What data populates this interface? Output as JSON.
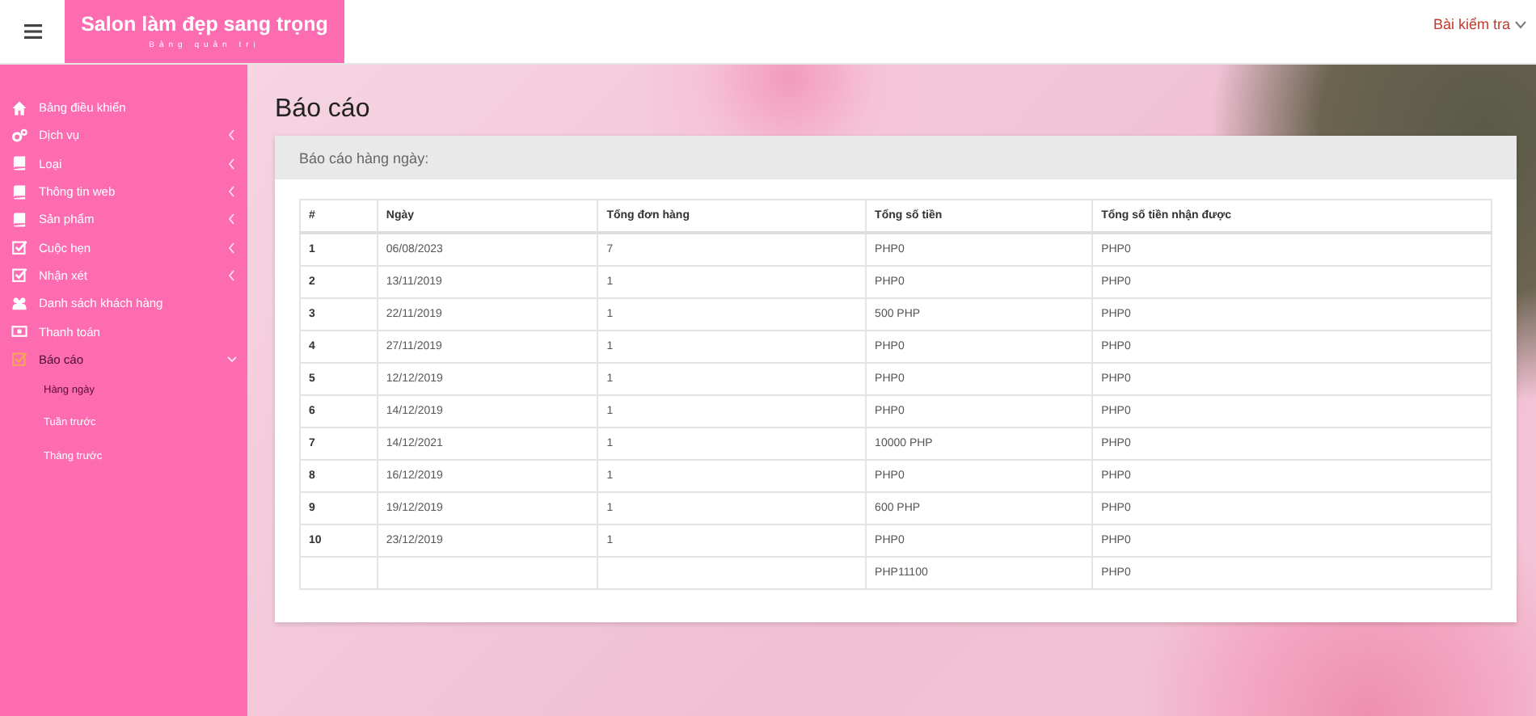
{
  "header": {
    "brand_title": "Salon làm đẹp sang trọng",
    "brand_subtitle": "Bảng quản trị",
    "user_menu": "Bài kiểm tra"
  },
  "sidebar": {
    "items": [
      {
        "kind": "home",
        "label": "Bảng điều khiển",
        "selected": false
      },
      {
        "kind": "gears",
        "label": "Dịch vụ",
        "selected": false,
        "expanded": false
      },
      {
        "kind": "book",
        "label": "Loại",
        "selected": false,
        "expanded": false
      },
      {
        "kind": "book",
        "label": "Thông tin web",
        "selected": false,
        "expanded": false
      },
      {
        "kind": "book",
        "label": "Sản phẩm",
        "selected": false,
        "expanded": false
      },
      {
        "kind": "check",
        "label": "Cuộc hẹn",
        "selected": false,
        "expanded": false
      },
      {
        "kind": "check",
        "label": "Nhận xét",
        "selected": false,
        "expanded": false
      },
      {
        "kind": "users",
        "label": "Danh sách khách hàng",
        "selected": false
      },
      {
        "kind": "money",
        "label": "Thanh toán",
        "selected": false
      },
      {
        "kind": "check",
        "label": "Báo cáo",
        "selected": true,
        "expanded": true,
        "children": [
          {
            "label": "Hàng ngày",
            "selected": true
          },
          {
            "label": "Tuần trước",
            "selected": false
          },
          {
            "label": "Tháng trước",
            "selected": false
          }
        ]
      }
    ]
  },
  "page_title": "Báo cáo",
  "panel": {
    "title": "Báo cáo hàng ngày:",
    "table": {
      "columns": [
        "#",
        "Ngày",
        "Tổng đơn hàng",
        "Tổng số tiền",
        "Tổng số tiền nhận được"
      ],
      "rows": [
        [
          "1",
          "06/08/2023",
          "7",
          "PHP0",
          "PHP0"
        ],
        [
          "2",
          "13/11/2019",
          "1",
          "PHP0",
          "PHP0"
        ],
        [
          "3",
          "22/11/2019",
          "1",
          "500 PHP",
          "PHP0"
        ],
        [
          "4",
          "27/11/2019",
          "1",
          "PHP0",
          "PHP0"
        ],
        [
          "5",
          "12/12/2019",
          "1",
          "PHP0",
          "PHP0"
        ],
        [
          "6",
          "14/12/2019",
          "1",
          "PHP0",
          "PHP0"
        ],
        [
          "7",
          "14/12/2021",
          "1",
          "10000 PHP",
          "PHP0"
        ],
        [
          "8",
          "16/12/2019",
          "1",
          "PHP0",
          "PHP0"
        ],
        [
          "9",
          "19/12/2019",
          "1",
          "600 PHP",
          "PHP0"
        ],
        [
          "10",
          "23/12/2019",
          "1",
          "PHP0",
          "PHP0"
        ],
        [
          "",
          "",
          "",
          "PHP11100",
          "PHP0"
        ]
      ]
    }
  }
}
